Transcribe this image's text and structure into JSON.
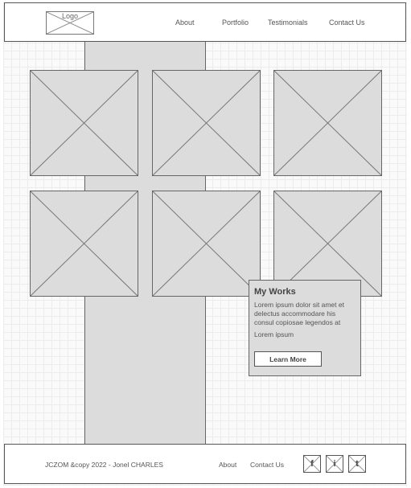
{
  "header": {
    "logo_label": "Logo",
    "nav": [
      {
        "label": "About"
      },
      {
        "label": "Portfolio"
      },
      {
        "label": "Testimonials"
      },
      {
        "label": "Contact Us"
      }
    ]
  },
  "gallery": {
    "item_count": 6
  },
  "card": {
    "title": "My Works",
    "body": "Lorem ipsum dolor sit amet et delectus accommodare his consul copiosae legendos at",
    "subtext": "Lorem ipsum",
    "button_label": "Learn More"
  },
  "footer": {
    "copyright": "JCZOM &copy 2022 - Jonel CHARLES",
    "links": [
      {
        "label": "About"
      },
      {
        "label": "Contact Us"
      }
    ],
    "social": [
      {
        "glyph": "f",
        "icon": "facebook-icon"
      },
      {
        "glyph": "i",
        "icon": "instagram-icon"
      },
      {
        "glyph": "t",
        "icon": "twitter-icon"
      }
    ]
  }
}
